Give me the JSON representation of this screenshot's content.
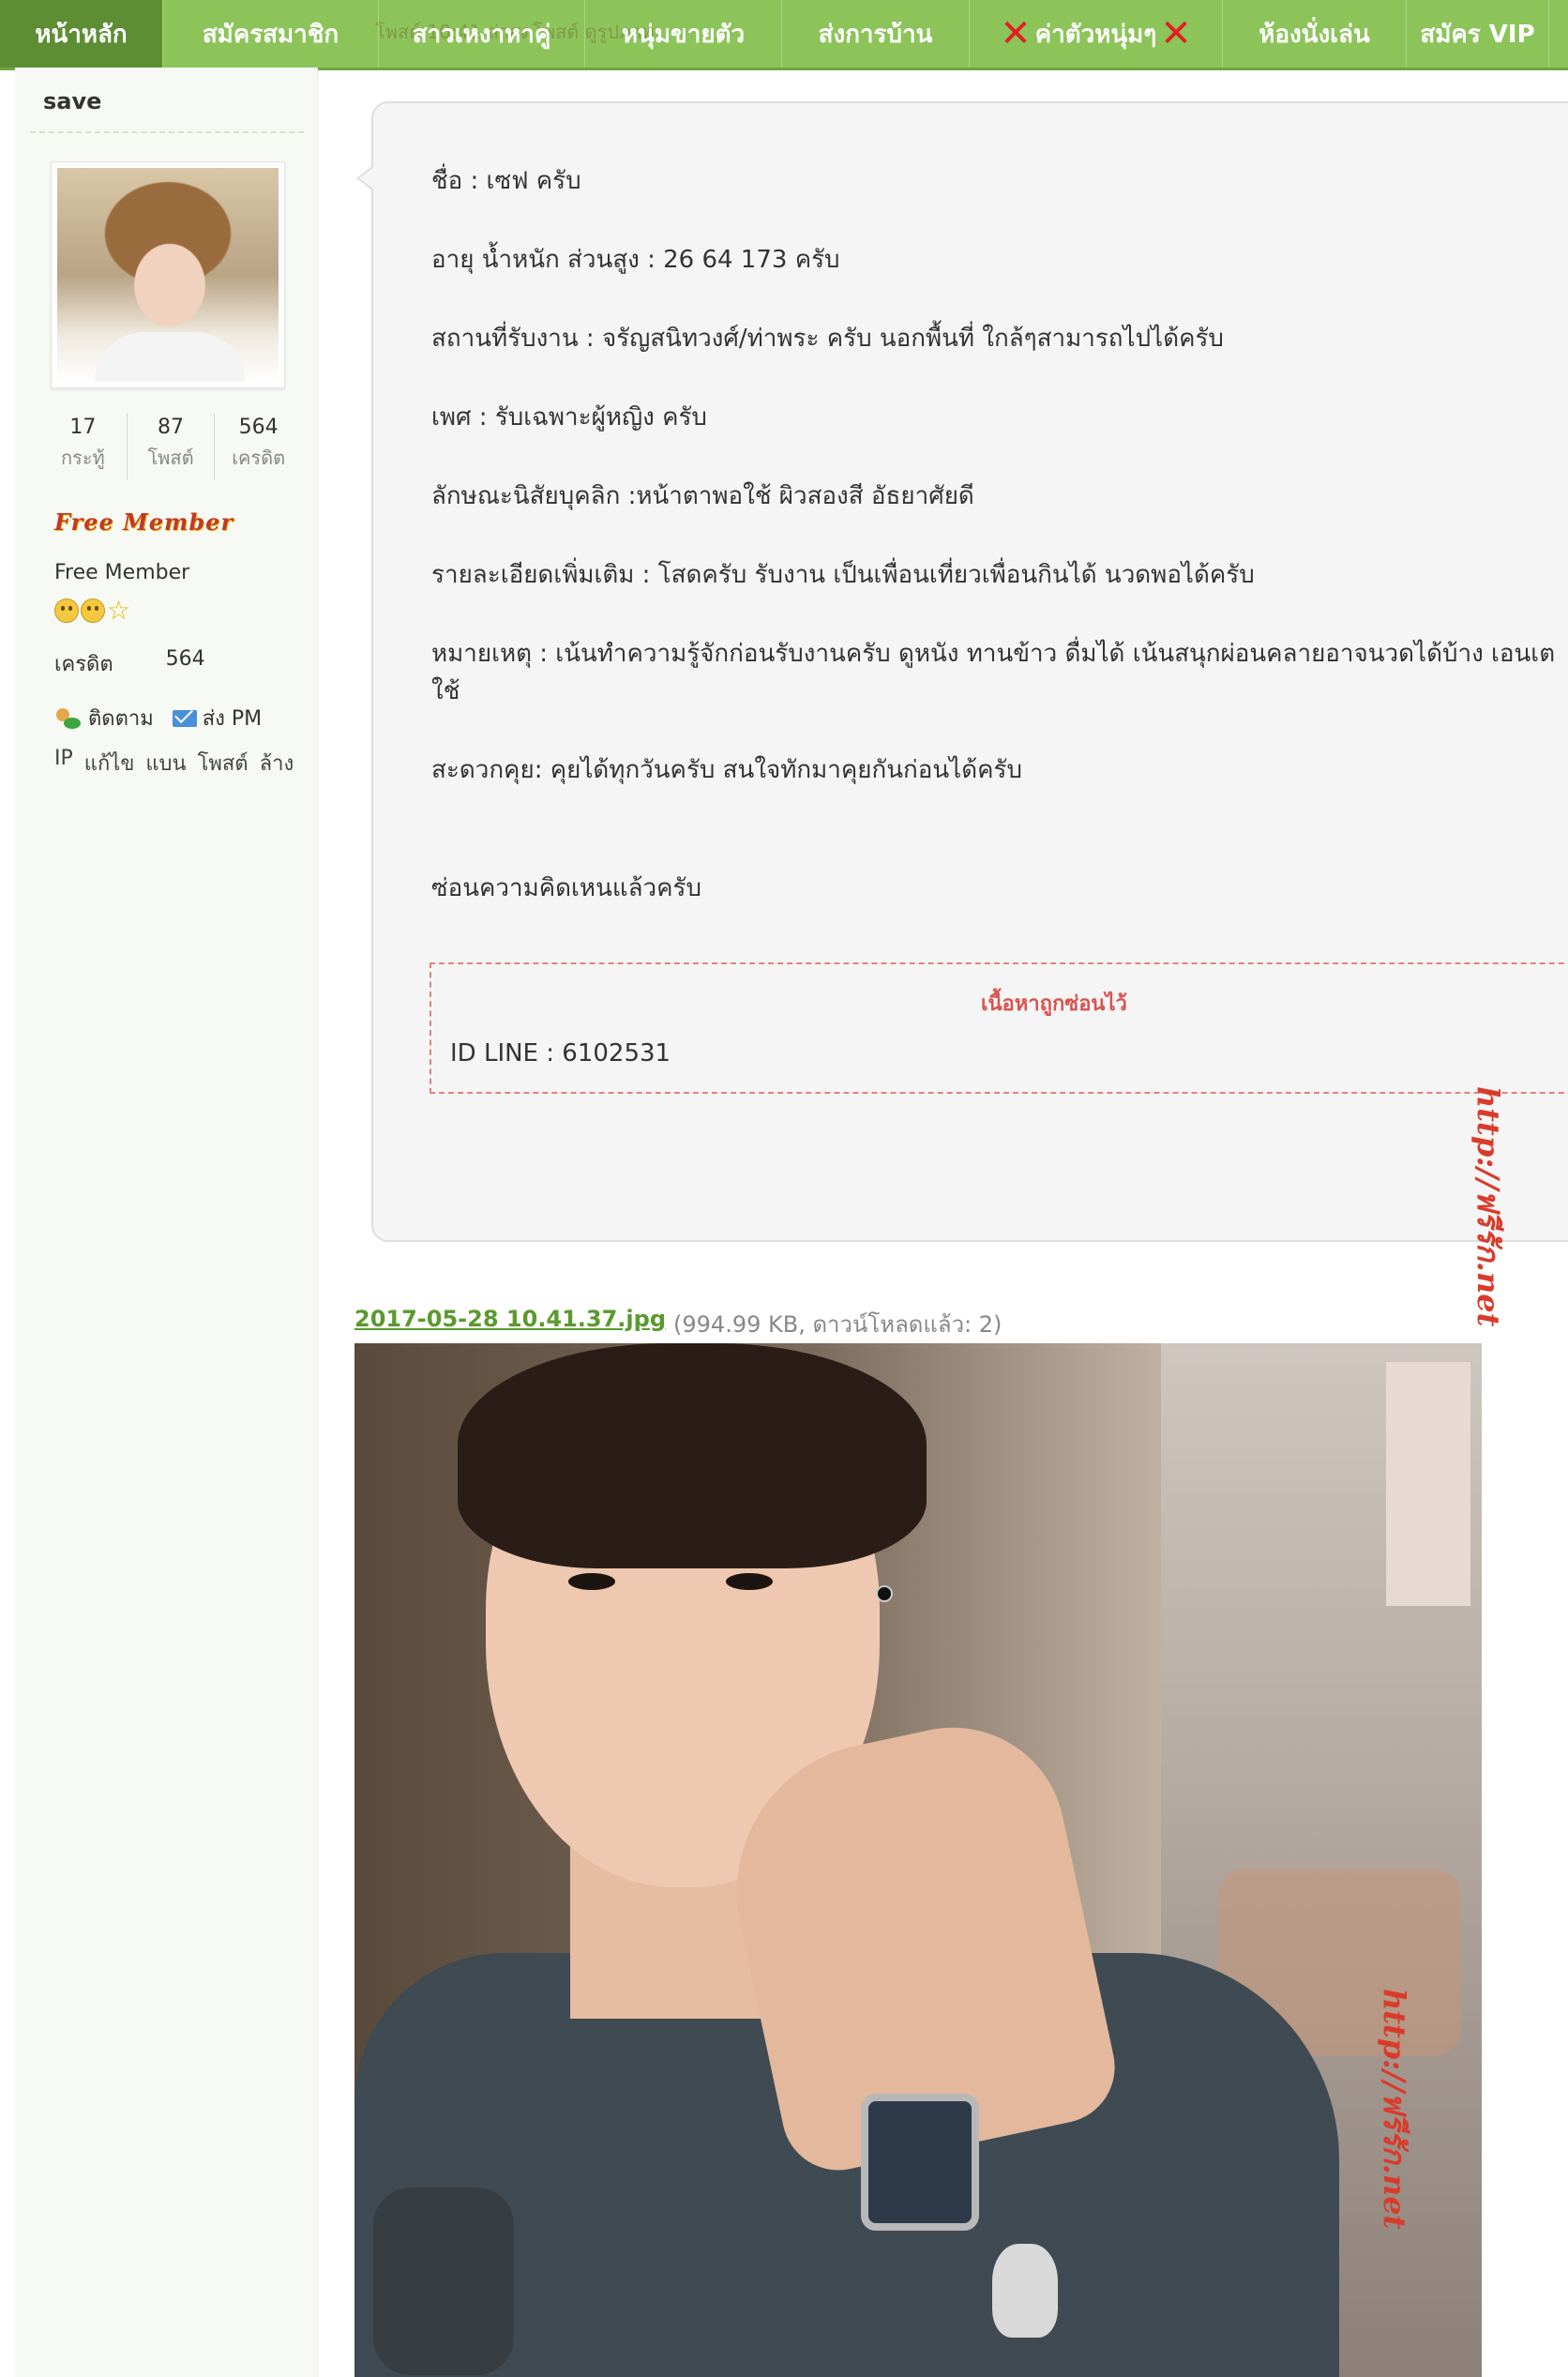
{
  "nav": {
    "items": [
      {
        "label": "หน้าหลัก",
        "active": true,
        "has_x": false
      },
      {
        "label": "สมัครสมาชิก",
        "active": false,
        "has_x": false
      },
      {
        "label": "สาวเหงาหาคู่",
        "active": false,
        "has_x": false
      },
      {
        "label": "หนุ่มขายตัว",
        "active": false,
        "has_x": false
      },
      {
        "label": "ส่งการบ้าน",
        "active": false,
        "has_x": false
      },
      {
        "label": "ค่าตัวหนุ่มๆ",
        "active": false,
        "has_x": true
      },
      {
        "label": "ห้องนั่งเล่น",
        "active": false,
        "has_x": false
      },
      {
        "label": "สมัคร VIP",
        "active": false,
        "has_x": false
      }
    ],
    "overlay_text": "โพสต์ 10:41 ล่าสุดโพสต์ ดูรูปภาพ"
  },
  "profile": {
    "username": "save",
    "stats": [
      {
        "value": "17",
        "label": "กระทู้"
      },
      {
        "value": "87",
        "label": "โพสต์"
      },
      {
        "value": "564",
        "label": "เครดิต"
      }
    ],
    "rank_title": "Free Member",
    "rank_text": "Free Member",
    "credit_label": "เครดิต",
    "credit_value": "564",
    "follow_label": "ติดตาม",
    "pm_label": "ส่ง PM",
    "admin_links": [
      "IP",
      "แก้ไข",
      "แบน",
      "โพสต์",
      "ล้าง"
    ]
  },
  "post": {
    "lines": [
      "ชื่อ : เซฟ ครับ",
      "อายุ น้ำหนัก ส่วนสูง : 26 64 173 ครับ",
      "สถานที่รับงาน : จรัญสนิทวงศ์/ท่าพระ ครับ นอกพื้นที่ ใกล้ๆสามารถไปได้ครับ",
      "เพศ :   รับเฉพาะผู้หญิง ครับ",
      "ลักษณะนิสัยบุคลิก :หน้าตาพอใช้  ผิวสองสี อัธยาศัยดี",
      "รายละเอียดเพิ่มเติม : โสดครับ รับงาน เป็นเพื่อนเที่ยวเพื่อนกินได้ นวดพอได้ครับ",
      "หมายเหตุ :  เน้นทำความรู้จักก่อนรับงานครับ ดูหนัง ทานข้าว ดื่มได้ เน้นสนุกผ่อนคลายอาจนวดได้บ้าง เอนเต",
      "ใช้",
      "สะดวกคุย: คุยได้ทุกวันครับ สนใจทักมาคุยกันก่อนได้ครับ",
      "ซ่อนความคิดเหนแล้วครับ"
    ],
    "hidden_title": "เนื้อหาถูกซ่อนไว้",
    "hidden_content": "ID LINE : 6102531",
    "watermark": "http://ฟรีรัก.net"
  },
  "attachment": {
    "filename": "2017-05-28 10.41.37.jpg",
    "meta": "(994.99 KB, ดาวน์โหลดแล้ว: 2)",
    "watermark": "http://ฟรีรัก.net"
  }
}
